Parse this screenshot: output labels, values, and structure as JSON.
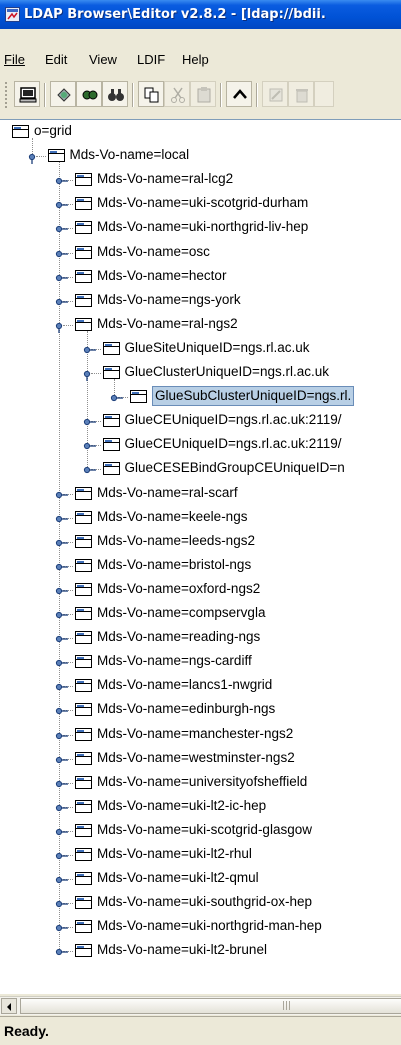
{
  "window": {
    "title": "LDAP Browser\\Editor v2.8.2 - [ldap://bdii."
  },
  "menu": {
    "items": [
      {
        "label": "File"
      },
      {
        "label": "Edit"
      },
      {
        "label": "View"
      },
      {
        "label": "LDIF"
      },
      {
        "label": "Help"
      }
    ]
  },
  "toolbar": {
    "buttons": [
      {
        "icon": "connect-icon",
        "enabled": true
      },
      {
        "icon": "refresh-icon",
        "enabled": true
      },
      {
        "icon": "search-icon",
        "enabled": true
      },
      {
        "icon": "find-icon",
        "enabled": true
      },
      {
        "icon": "copy-icon",
        "enabled": true
      },
      {
        "icon": "cut-icon",
        "enabled": false
      },
      {
        "icon": "paste-icon",
        "enabled": false
      },
      {
        "icon": "up-icon",
        "enabled": true
      },
      {
        "icon": "edit-icon",
        "enabled": false
      },
      {
        "icon": "delete-icon",
        "enabled": false
      }
    ]
  },
  "tree": {
    "nodes": [
      {
        "label": "o=grid",
        "depth": 0,
        "expanded": true
      },
      {
        "label": "Mds-Vo-name=local",
        "depth": 1,
        "expanded": true
      },
      {
        "label": "Mds-Vo-name=ral-lcg2",
        "depth": 2,
        "expanded": false
      },
      {
        "label": "Mds-Vo-name=uki-scotgrid-durham",
        "depth": 2,
        "expanded": false
      },
      {
        "label": "Mds-Vo-name=uki-northgrid-liv-hep",
        "depth": 2,
        "expanded": false
      },
      {
        "label": "Mds-Vo-name=osc",
        "depth": 2,
        "expanded": false
      },
      {
        "label": "Mds-Vo-name=hector",
        "depth": 2,
        "expanded": false
      },
      {
        "label": "Mds-Vo-name=ngs-york",
        "depth": 2,
        "expanded": false
      },
      {
        "label": "Mds-Vo-name=ral-ngs2",
        "depth": 2,
        "expanded": true
      },
      {
        "label": "GlueSiteUniqueID=ngs.rl.ac.uk",
        "depth": 3,
        "expanded": false
      },
      {
        "label": "GlueClusterUniqueID=ngs.rl.ac.uk",
        "depth": 3,
        "expanded": true
      },
      {
        "label": "GlueSubClusterUniqueID=ngs.rl.",
        "depth": 4,
        "expanded": false,
        "selected": true
      },
      {
        "label": "GlueCEUniqueID=ngs.rl.ac.uk:2119/",
        "depth": 3,
        "expanded": false
      },
      {
        "label": "GlueCEUniqueID=ngs.rl.ac.uk:2119/",
        "depth": 3,
        "expanded": false
      },
      {
        "label": "GlueCESEBindGroupCEUniqueID=n",
        "depth": 3,
        "expanded": false
      },
      {
        "label": "Mds-Vo-name=ral-scarf",
        "depth": 2,
        "expanded": false
      },
      {
        "label": "Mds-Vo-name=keele-ngs",
        "depth": 2,
        "expanded": false
      },
      {
        "label": "Mds-Vo-name=leeds-ngs2",
        "depth": 2,
        "expanded": false
      },
      {
        "label": "Mds-Vo-name=bristol-ngs",
        "depth": 2,
        "expanded": false
      },
      {
        "label": "Mds-Vo-name=oxford-ngs2",
        "depth": 2,
        "expanded": false
      },
      {
        "label": "Mds-Vo-name=compservgla",
        "depth": 2,
        "expanded": false
      },
      {
        "label": "Mds-Vo-name=reading-ngs",
        "depth": 2,
        "expanded": false
      },
      {
        "label": "Mds-Vo-name=ngs-cardiff",
        "depth": 2,
        "expanded": false
      },
      {
        "label": "Mds-Vo-name=lancs1-nwgrid",
        "depth": 2,
        "expanded": false
      },
      {
        "label": "Mds-Vo-name=edinburgh-ngs",
        "depth": 2,
        "expanded": false
      },
      {
        "label": "Mds-Vo-name=manchester-ngs2",
        "depth": 2,
        "expanded": false
      },
      {
        "label": "Mds-Vo-name=westminster-ngs2",
        "depth": 2,
        "expanded": false
      },
      {
        "label": "Mds-Vo-name=universityofsheffield",
        "depth": 2,
        "expanded": false
      },
      {
        "label": "Mds-Vo-name=uki-lt2-ic-hep",
        "depth": 2,
        "expanded": false
      },
      {
        "label": "Mds-Vo-name=uki-scotgrid-glasgow",
        "depth": 2,
        "expanded": false
      },
      {
        "label": "Mds-Vo-name=uki-lt2-rhul",
        "depth": 2,
        "expanded": false
      },
      {
        "label": "Mds-Vo-name=uki-lt2-qmul",
        "depth": 2,
        "expanded": false
      },
      {
        "label": "Mds-Vo-name=uki-southgrid-ox-hep",
        "depth": 2,
        "expanded": false
      },
      {
        "label": "Mds-Vo-name=uki-northgrid-man-hep",
        "depth": 2,
        "expanded": false
      },
      {
        "label": "Mds-Vo-name=uki-lt2-brunel",
        "depth": 2,
        "expanded": false
      }
    ]
  },
  "status": {
    "text": "Ready."
  },
  "colors": {
    "title_bar": "#0052d6",
    "selection": "#b8cfe5",
    "chrome": "#ece9d8"
  }
}
